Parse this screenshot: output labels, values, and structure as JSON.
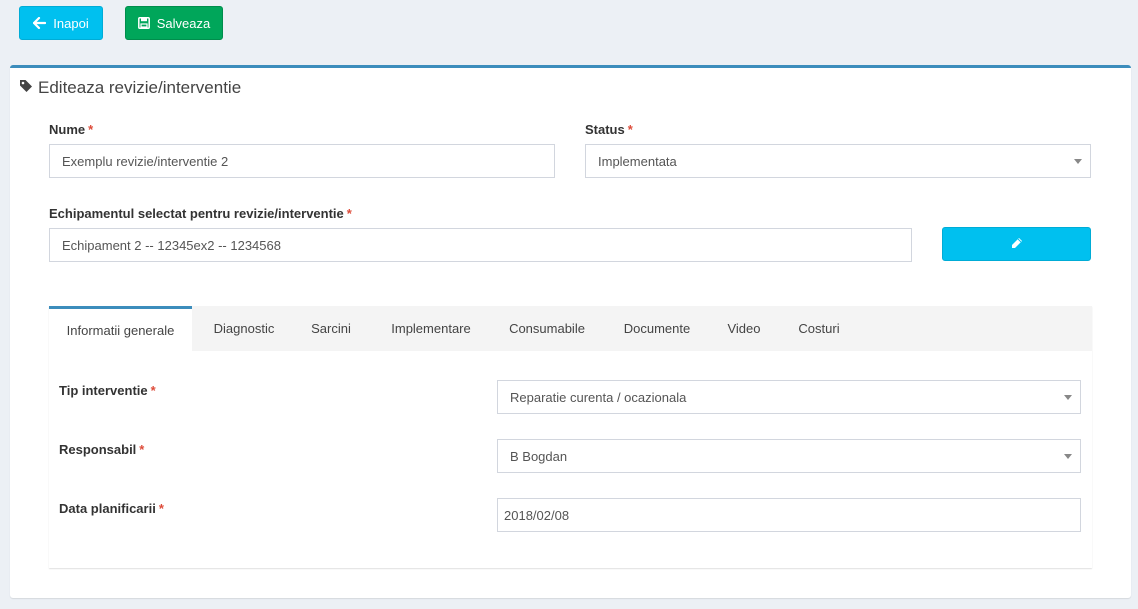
{
  "toolbar": {
    "back_label": "Inapoi",
    "save_label": "Salveaza"
  },
  "box": {
    "title": "Editeaza revizie/interventie"
  },
  "form": {
    "name_label": "Nume",
    "name_value": "Exemplu revizie/interventie 2",
    "status_label": "Status",
    "status_value": "Implementata",
    "equipment_label": "Echipamentul selectat pentru revizie/interventie",
    "equipment_value": "Echipament 2 -- 12345ex2 -- 1234568",
    "required_mark": "*"
  },
  "tabs": [
    {
      "label": "Informatii generale",
      "active": true
    },
    {
      "label": "Diagnostic"
    },
    {
      "label": "Sarcini"
    },
    {
      "label": "Implementare"
    },
    {
      "label": "Consumabile"
    },
    {
      "label": "Documente"
    },
    {
      "label": "Video"
    },
    {
      "label": "Costuri"
    }
  ],
  "general": {
    "type_label": "Tip interventie",
    "type_value": "Reparatie curenta / ocazionala",
    "responsible_label": "Responsabil",
    "responsible_value": "B Bogdan",
    "date_label": "Data planificarii",
    "date_value": "2018/02/08"
  },
  "colors": {
    "info": "#00c0ef",
    "success": "#00a65a",
    "primary": "#3c8dbc",
    "danger": "#dd4b39"
  },
  "icons": {
    "back": "arrow-left-icon",
    "save": "floppy-disk-icon",
    "title": "tag-icon",
    "edit": "pencil-icon"
  }
}
